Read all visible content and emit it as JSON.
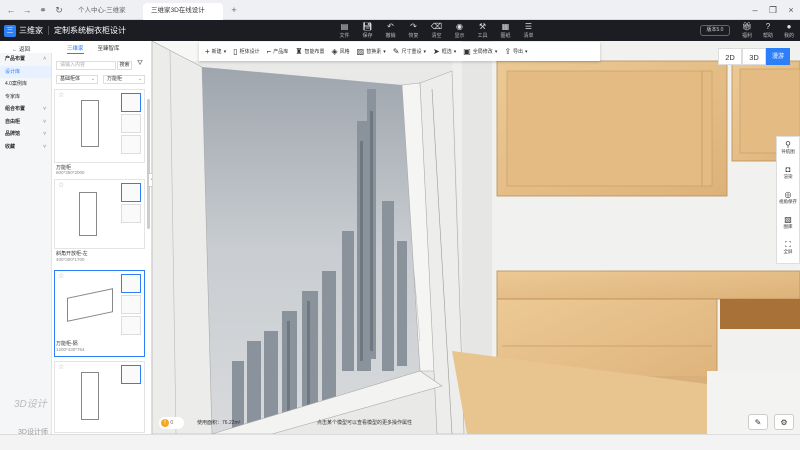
{
  "browser": {
    "tabs": [
      {
        "label": "个人中心-三维家",
        "active": false
      },
      {
        "label": "三维家3D在线设计",
        "active": true
      }
    ],
    "new_tab": "+"
  },
  "header": {
    "logo_text": "三维家",
    "product_name": "定制系统橱衣柜设计",
    "menus": [
      {
        "icon": "file-icon",
        "label": "文件"
      },
      {
        "icon": "save-icon",
        "label": "保存"
      },
      {
        "icon": "undo-icon",
        "label": "撤销"
      },
      {
        "icon": "redo-icon",
        "label": "恢复"
      },
      {
        "icon": "clear-icon",
        "label": "清空"
      },
      {
        "icon": "display-icon",
        "label": "显示"
      },
      {
        "icon": "tools-icon",
        "label": "工具"
      },
      {
        "icon": "drawing-icon",
        "label": "图纸"
      },
      {
        "icon": "list-icon",
        "label": "清单"
      }
    ],
    "upgrade": "版本5.0",
    "right": [
      {
        "icon": "gift-icon",
        "label": "福利"
      },
      {
        "icon": "help-icon",
        "label": "帮助"
      },
      {
        "icon": "user-icon",
        "label": "我的"
      }
    ]
  },
  "left": {
    "back": "返回",
    "tabs": [
      {
        "label": "三维家",
        "active": true
      },
      {
        "label": "至臻智库",
        "active": false
      }
    ],
    "categories": [
      {
        "label": "产品布置",
        "type": "section",
        "chev": "˄"
      },
      {
        "label": "设计库",
        "type": "item",
        "active": true
      },
      {
        "label": "4.0案例库",
        "type": "item"
      },
      {
        "label": "专家库",
        "type": "item"
      },
      {
        "label": "组合布置",
        "type": "section",
        "chev": "˅"
      },
      {
        "label": "自由柜",
        "type": "section",
        "chev": "˅"
      },
      {
        "label": "品牌馆",
        "type": "section",
        "chev": "˅"
      },
      {
        "label": "收藏",
        "type": "section",
        "chev": "˅"
      }
    ],
    "search_placeholder": "请输入内容",
    "search_button": "搜索",
    "select1": "基础柜体",
    "select2": "万能柜",
    "products": [
      {
        "name": "万能柜",
        "dims": "600*350*2000"
      },
      {
        "name": "斜角开放柜-左",
        "dims": "400*300*1700"
      },
      {
        "name": "万能柜-隔",
        "dims": "1200*430*764"
      },
      {
        "name": "",
        "dims": ""
      }
    ]
  },
  "toolbar": [
    {
      "icon": "plus-icon",
      "label": "新建",
      "dd": true
    },
    {
      "icon": "cabinet-icon",
      "label": "柜体设计",
      "dd": false
    },
    {
      "icon": "leg-icon",
      "label": "产品库",
      "dd": false
    },
    {
      "icon": "smart-icon",
      "label": "智能布置",
      "dd": false
    },
    {
      "icon": "style-icon",
      "label": "风格",
      "dd": false
    },
    {
      "icon": "material-icon",
      "label": "替换素",
      "dd": true
    },
    {
      "icon": "ruler-icon",
      "label": "尺寸重设",
      "dd": true
    },
    {
      "icon": "cursor-icon",
      "label": "框选",
      "dd": true
    },
    {
      "icon": "batch-icon",
      "label": "全局修改",
      "dd": true
    },
    {
      "icon": "export-icon",
      "label": "导出",
      "dd": true
    }
  ],
  "views": [
    {
      "label": "2D",
      "active": false
    },
    {
      "label": "3D",
      "active": false
    },
    {
      "label": "漫游",
      "active": true
    }
  ],
  "right_tools": [
    {
      "icon": "navigation-icon",
      "label": "导航图"
    },
    {
      "icon": "camera-icon",
      "label": "渲染"
    },
    {
      "icon": "view-angle-icon",
      "label": "视角保存"
    },
    {
      "icon": "image-icon",
      "label": "图库"
    },
    {
      "icon": "fullscreen-icon",
      "label": "全屏"
    }
  ],
  "bottom": {
    "warnings": "0",
    "status": "使用面积：76.22m²",
    "hint": "点击某个模型可以查看模型的更多操作属性",
    "buttons": [
      "pencil-icon",
      "settings-icon"
    ]
  },
  "watermark": {
    "line1": "3D设计",
    "line2": "3D设计师"
  },
  "colors": {
    "accent": "#2d7ff9",
    "header": "#1b1d22",
    "wood": "#e8c48f"
  }
}
